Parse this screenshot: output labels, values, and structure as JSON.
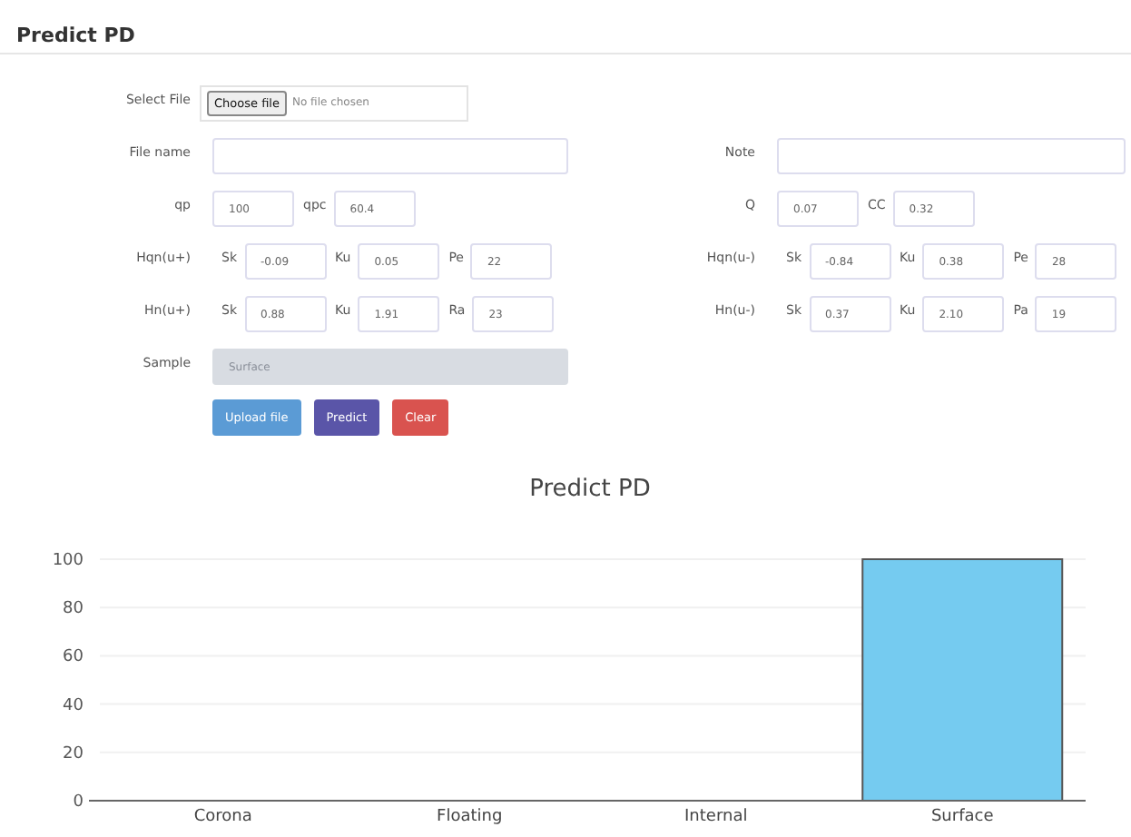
{
  "header": {
    "title": "Predict PD"
  },
  "form": {
    "rows": [
      {
        "left": {
          "kind": "file",
          "label": "Select File",
          "button": "Choose file",
          "status": "No file chosen"
        }
      },
      {
        "left": {
          "kind": "text",
          "label": "File name",
          "disabled": false
        },
        "right": {
          "kind": "text",
          "label": "Note",
          "disabled": false
        }
      },
      {
        "left": {
          "kind": "fields",
          "label": "qp",
          "fields": [
            {
              "value": "100"
            },
            {
              "label": "qpc",
              "value": "60.4"
            }
          ]
        },
        "right": {
          "kind": "fields",
          "label": "Q",
          "fields": [
            {
              "value": "0.07"
            },
            {
              "label": "CC",
              "value": "0.32"
            }
          ]
        }
      },
      {
        "left": {
          "kind": "fields",
          "label": "Hqn(u+)",
          "fields": [
            {
              "label": "Sk",
              "value": "-0.09"
            },
            {
              "label": "Ku",
              "value": "0.05"
            },
            {
              "label": "Pe",
              "value": "22"
            }
          ]
        },
        "right": {
          "kind": "fields",
          "label": "Hqn(u-)",
          "fields": [
            {
              "label": "Sk",
              "value": "-0.84"
            },
            {
              "label": "Ku",
              "value": "0.38"
            },
            {
              "label": "Pe",
              "value": "28"
            }
          ]
        }
      },
      {
        "left": {
          "kind": "fields",
          "label": "Hn(u+)",
          "fields": [
            {
              "label": "Sk",
              "value": "0.88"
            },
            {
              "label": "Ku",
              "value": "1.91"
            },
            {
              "label": "Ra",
              "value": "23"
            }
          ]
        },
        "right": {
          "kind": "fields",
          "label": "Hn(u-)",
          "fields": [
            {
              "label": "Sk",
              "value": "0.37"
            },
            {
              "label": "Ku",
              "value": "2.10"
            },
            {
              "label": "Pa",
              "value": "19"
            }
          ]
        }
      },
      {
        "left": {
          "kind": "text",
          "label": "Sample",
          "value": "Surface",
          "disabled": true
        }
      }
    ],
    "buttons": [
      {
        "label": "Upload file",
        "color": "#5b9bd5"
      },
      {
        "label": "Predict",
        "color": "#5a55a8"
      },
      {
        "label": "Clear",
        "color": "#d9534f"
      }
    ]
  },
  "chart": {
    "chart_data": {
      "type": "bar",
      "title": "Predict PD",
      "categories": [
        "Corona",
        "Floating",
        "Internal",
        "Surface"
      ],
      "values": [
        0,
        0,
        0,
        100
      ],
      "ylim": [
        0,
        100
      ],
      "grid": true,
      "yticks": [
        0,
        20,
        40,
        60,
        80,
        100
      ]
    }
  }
}
